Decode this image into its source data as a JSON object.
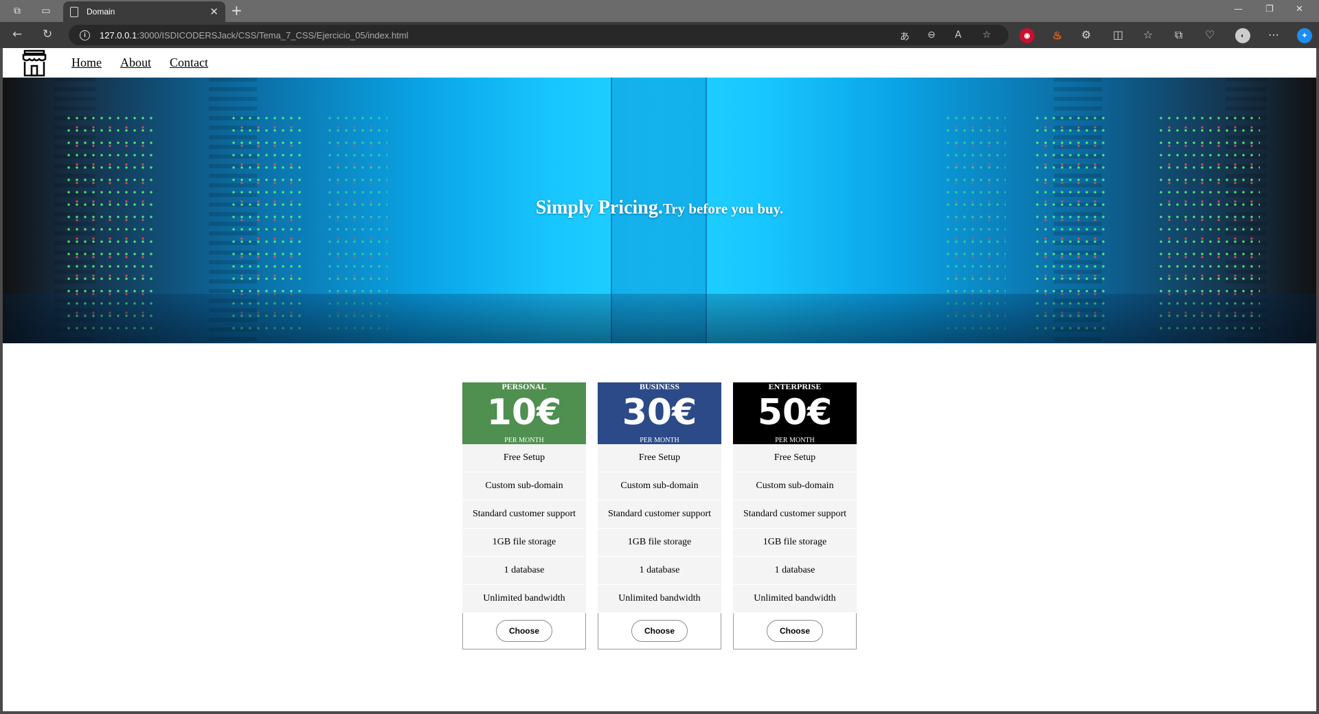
{
  "browser": {
    "tab_title": "Domain",
    "url_host": "127.0.0.1",
    "url_rest": ":3000/ISDICODERSJack/CSS/Tema_7_CSS/Ejercicio_05/index.html"
  },
  "nav": {
    "links": [
      "Home",
      "About",
      "Contact"
    ]
  },
  "hero": {
    "title": "Simply Pricing.",
    "subtitle": "Try before you buy."
  },
  "plans": [
    {
      "name": "PERSONAL",
      "price": "10€",
      "period": "PER MONTH",
      "color": "#4f8f4f",
      "features": [
        "Free Setup",
        "Custom sub-domain",
        "Standard customer support",
        "1GB file storage",
        "1 database",
        "Unlimited bandwidth"
      ],
      "button": "Choose"
    },
    {
      "name": "BUSINESS",
      "price": "30€",
      "period": "PER MONTH",
      "color": "#2c4a87",
      "features": [
        "Free Setup",
        "Custom sub-domain",
        "Standard customer support",
        "1GB file storage",
        "1 database",
        "Unlimited bandwidth"
      ],
      "button": "Choose"
    },
    {
      "name": "ENTERPRISE",
      "price": "50€",
      "period": "PER MONTH",
      "color": "#000000",
      "features": [
        "Free Setup",
        "Custom sub-domain",
        "Standard customer support",
        "1GB file storage",
        "1 database",
        "Unlimited bandwidth"
      ],
      "button": "Choose"
    }
  ]
}
